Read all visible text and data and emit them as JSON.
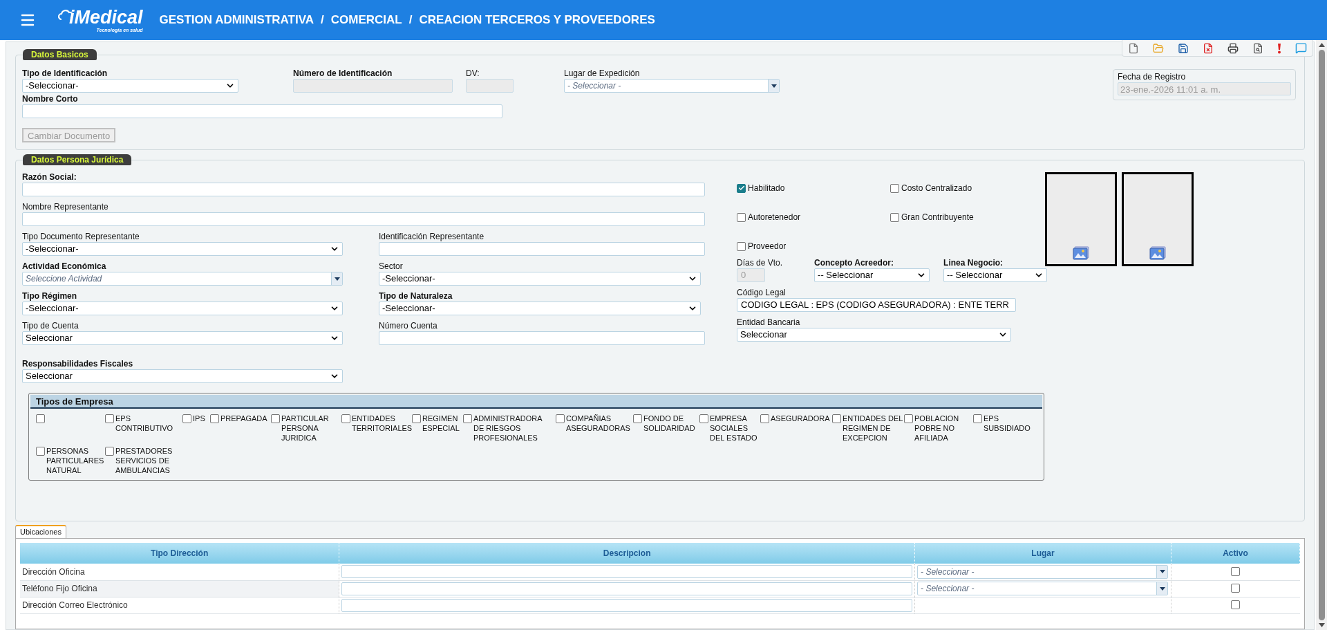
{
  "header": {
    "logo": "iMedical",
    "tagline": "Tecnología en salud",
    "breadcrumb": [
      "GESTION ADMINISTRATIVA",
      "COMERCIAL",
      "CREACION TERCEROS Y PROVEEDORES"
    ],
    "separator": "/"
  },
  "datos_basicos": {
    "legend": "Datos Basicos",
    "fields": [
      {
        "label": "Tipo de Identificación",
        "required": true,
        "kind": "select",
        "value": "-Seleccionar-",
        "disabled": false
      },
      {
        "label": "Número de Identificación",
        "required": true,
        "kind": "text",
        "disabled": true
      },
      {
        "label": "DV:",
        "required": false,
        "kind": "text",
        "disabled": true
      },
      {
        "label": "Lugar de Expedición",
        "required": false,
        "kind": "combo",
        "placeholder": "- Seleccionar -",
        "disabled": false
      }
    ],
    "nombre_corto": {
      "label": "Nombre Corto",
      "required": true,
      "kind": "text",
      "disabled": false
    },
    "button": {
      "label": "Cambiar Documento",
      "disabled": true
    },
    "fecha_registro": {
      "label": "Fecha de Registro",
      "value": "23-ene.-2026 11:01 a. m."
    }
  },
  "datos_persona_juridica": {
    "legend": "Datos Persona Jurídica",
    "rows": [
      [
        {
          "label": "Razón Social:",
          "required": true,
          "kind": "text",
          "disabled": false
        }
      ],
      [
        {
          "label": "Nombre Representante",
          "required": false,
          "kind": "text",
          "disabled": false
        }
      ],
      [
        {
          "label": "Tipo Documento Representante",
          "required": false,
          "kind": "select",
          "value": "-Seleccionar-",
          "disabled": false
        },
        {
          "label": "Identificación Representante",
          "required": false,
          "kind": "text",
          "disabled": false
        }
      ],
      [
        {
          "label": "Actividad Económica",
          "required": true,
          "kind": "combo",
          "placeholder": "Seleccione Actividad",
          "disabled": false
        },
        {
          "label": "Sector",
          "required": false,
          "kind": "select",
          "value": "-Seleccionar-",
          "disabled": false
        }
      ],
      [
        {
          "label": "Tipo Régimen",
          "required": true,
          "kind": "select",
          "value": "-Seleccionar-",
          "disabled": false
        },
        {
          "label": "Tipo de Naturaleza",
          "required": true,
          "kind": "select",
          "value": "-Seleccionar-",
          "disabled": false
        }
      ],
      [
        {
          "label": "Tipo de Cuenta",
          "required": false,
          "kind": "select",
          "value": "Seleccionar",
          "disabled": false
        },
        {
          "label": "Número Cuenta",
          "required": false,
          "kind": "text",
          "disabled": false
        }
      ],
      [
        {
          "label": "Responsabilidades Fiscales",
          "required": true,
          "kind": "select",
          "value": "Seleccionar",
          "disabled": false
        }
      ]
    ],
    "checks": [
      {
        "label": "Habilitado",
        "checked": true
      },
      {
        "label": "Costo Centralizado",
        "checked": false
      },
      {
        "label": "Autoretenedor",
        "checked": false
      },
      {
        "label": "Gran Contribuyente",
        "checked": false
      },
      {
        "label": "Proveedor",
        "checked": false
      }
    ],
    "terms": [
      {
        "label": "Días de Vto.",
        "required": false,
        "kind": "text",
        "value": "0",
        "disabled": true
      },
      {
        "label": "Concepto Acreedor:",
        "required": true,
        "kind": "select",
        "value": "-- Seleccionar",
        "disabled": false
      },
      {
        "label": "Linea Negocio:",
        "required": true,
        "kind": "select",
        "value": "-- Seleccionar",
        "disabled": false
      }
    ],
    "codigo_legal": {
      "label": "Código Legal",
      "required": false,
      "kind": "text",
      "value": "CODIGO LEGAL : EPS (CODIGO ASEGURADORA) : ENTE TERR",
      "disabled": false
    },
    "entidad_bancaria": {
      "label": "Entidad Bancaria",
      "required": false,
      "kind": "select",
      "value": "Seleccionar",
      "disabled": false
    },
    "tipos_empresa": {
      "title": "Tipos de Empresa",
      "items": [
        {
          "checked": false
        },
        {
          "label": "EPS CONTRIBUTIVO",
          "checked": false
        },
        {
          "label": "IPS",
          "checked": false
        },
        {
          "label": "PREPAGADA",
          "checked": false
        },
        {
          "label": "PARTICULAR PERSONA JURIDICA",
          "checked": false
        },
        {
          "label": "ENTIDADES TERRITORIALES",
          "checked": false
        },
        {
          "label": "REGIMEN ESPECIAL",
          "checked": false
        },
        {
          "label": "ADMINISTRADORA DE RIESGOS PROFESIONALES",
          "checked": false
        },
        {
          "label": "COMPAÑIAS ASEGURADORAS",
          "checked": false
        },
        {
          "label": "FONDO DE SOLIDARIDAD",
          "checked": false
        },
        {
          "label": "EMPRESA SOCIALES DEL ESTADO",
          "checked": false
        },
        {
          "label": "ASEGURADORA",
          "checked": false
        },
        {
          "label": "ENTIDADES DEL REGIMEN DE EXCEPCION",
          "checked": false
        },
        {
          "label": "POBLACION POBRE NO AFILIADA",
          "checked": false
        },
        {
          "label": "EPS SUBSIDIADO",
          "checked": false
        },
        {
          "label": "PERSONAS PARTICULARES NATURAL",
          "checked": false
        },
        {
          "label": "PRESTADORES SERVICIOS DE AMBULANCIAS",
          "checked": false
        }
      ]
    }
  },
  "ubicaciones": {
    "tabs": [
      {
        "label": "Ubicaciones",
        "selected": true
      }
    ],
    "columns": [
      "Tipo Dirección",
      "Descripcion",
      "Lugar",
      "Activo"
    ],
    "rows": [
      {
        "tipo": "Dirección Oficina",
        "lugar": "- Seleccionar -",
        "activo": false
      },
      {
        "tipo": "Teléfono Fijo Oficina",
        "lugar": "- Seleccionar -",
        "activo": false
      },
      {
        "tipo": "Dirección Correo Electrónico",
        "activo": false
      }
    ]
  }
}
